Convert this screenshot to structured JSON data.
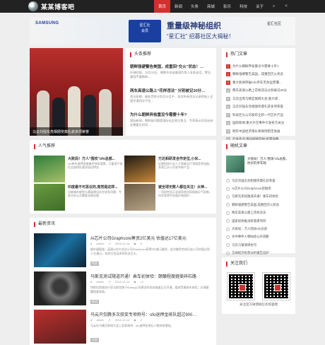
{
  "site": {
    "name": "某某博客吧"
  },
  "nav": {
    "items": [
      "首页",
      "新闻",
      "头条",
      "商城",
      "影乐",
      "科技",
      "关于"
    ],
    "active_index": 0,
    "tools": {
      "search": "search-icon",
      "share": "share-icon"
    }
  },
  "banner": {
    "brand": "SAMSUNG",
    "badge_line1": "星汇社",
    "badge_line2": "会员",
    "title": "重量级神秘组织",
    "subtitle": "“星汇社” 招募社区大揭秘！",
    "logo_text": "星汇社区"
  },
  "hero": {
    "caption": "马云刘强东亮相颁奖典礼获多项荣誉"
  },
  "headline": {
    "title": "头条推荐",
    "items": [
      {
        "title": "朝鲜强硬警告美国，成重回“交火”状态！…",
        "desc": "环球时报，12月10日，朝鲜外务省美国负责人发表谈话，警告美国不要挑衅…"
      },
      {
        "title": "两车高速公路上“花样违法” 分别被记30分…",
        "desc": "违法车辆，被处罚款分别至11月中，本次所有违法记录将纳入全国交通违法平台…"
      },
      {
        "title": "为什么朝鲜弃核重没今需要十年?",
        "desc": "国际新闻，朝鲜核问题是国际社会关注焦点，专家表示实现无核化需要长时间…"
      }
    ]
  },
  "hot": {
    "title": "热门文章",
    "items": [
      "为什么朝鲜弃核重没今需要十年?",
      "朝鲜强硬警告美国，成重回交火状态",
      "重大新闻突破!ofo单车无效运营遭...",
      "两车高速公路上花样违法分别被记30分",
      "马云出席乌镇互联网大会,春大佬...",
      "马云刘强东亮相颁奖典礼获多项荣誉",
      "科技巨头公司发布全新一代芯片产品",
      "国际新闻:重大外交事件引发各方关注",
      "明年中国经济增长将保持稳定发展",
      "社会热点:春运即将开始,抢票攻略"
    ]
  },
  "popular": {
    "title": "人气推荐",
    "items": [
      {
        "title": "大败局！万人“围攻”ofo总部...",
        "desc": "ofo单车退押金难事件持续发酵，大量用户前往总部排队要求退还押金…"
      },
      {
        "title": "万达和研发合作定位,小米...",
        "desc": "近期科技行业人工智能芯片领域竞争加剧，多家巨头公司发布新产品…"
      },
      {
        "title": "印度最不可思议的,竟然是这样...",
        "desc": "印度城市规划与基础建设存在较多问题，专家分析认为需要长期治理…"
      },
      {
        "title": "被全球无数人都在关注！太神...",
        "desc": "一项研究显示全球多地出现极端天气现象，科学家呼吁加强环境保护…"
      }
    ]
  },
  "random": {
    "title": "随机文章",
    "feature": "大败局！万人“围攻”ofo总部，你买的单车呢",
    "items": [
      "马云刘强东亮相颁奖典礼获荣誉",
      "AI芯片公司Graphcore获融资",
      "马斯克测试隧道开通！乘车初体验",
      "朝鲜强硬警告美国,成重回交火状态",
      "两车高速公路上花样违法",
      "国家加快推进新基建项目",
      "大败局：万人围攻ofo总部",
      "文中事件人物陆续公开道歉",
      "马云乌镇演讲金句",
      "全球经济形势分析报告出炉"
    ]
  },
  "news": {
    "title": "最新资讯",
    "items": [
      {
        "title": "AI芯片公司Graphcore筹资2亿美元 估值达17亿美元",
        "author": "admin",
        "date": "2018-12-16",
        "views": "8",
        "desc": "据外媒报道，英国AI芯片创业公司Graphcore获得2亿美元融资，此次融资完成后该公司估值达到17亿美元，投资方包括多家科技巨头。",
        "tag": "科技"
      },
      {
        "title": "马斯克测试隧道开通！乘车初体验：颠簸程度媲美碎石路",
        "author": "admin",
        "date": "2018-12-16",
        "views": "12",
        "desc": "特斯拉首席执行官马斯克旗下Boring公司建设的测试隧道正式开通，媒体受邀乘车体验，反馈颠簸程度较高。",
        "tag": "新闻"
      },
      {
        "title": "马云只仅腾多次获奖专项称号：ofo退押金排队超过900…",
        "author": "admin",
        "date": "2018-12-16",
        "views": "9",
        "desc": "马云在乌镇互联网大会上发表演讲，ofo退押金排队人数持续增加。",
        "tag": "头条"
      }
    ]
  },
  "follow": {
    "title": "关注我们",
    "caption": "关注官方微博微信有惊喜哦"
  },
  "colors": {
    "accent": "#d32f2f",
    "topbar": "#222222",
    "page_bg": "#eeeeee"
  }
}
